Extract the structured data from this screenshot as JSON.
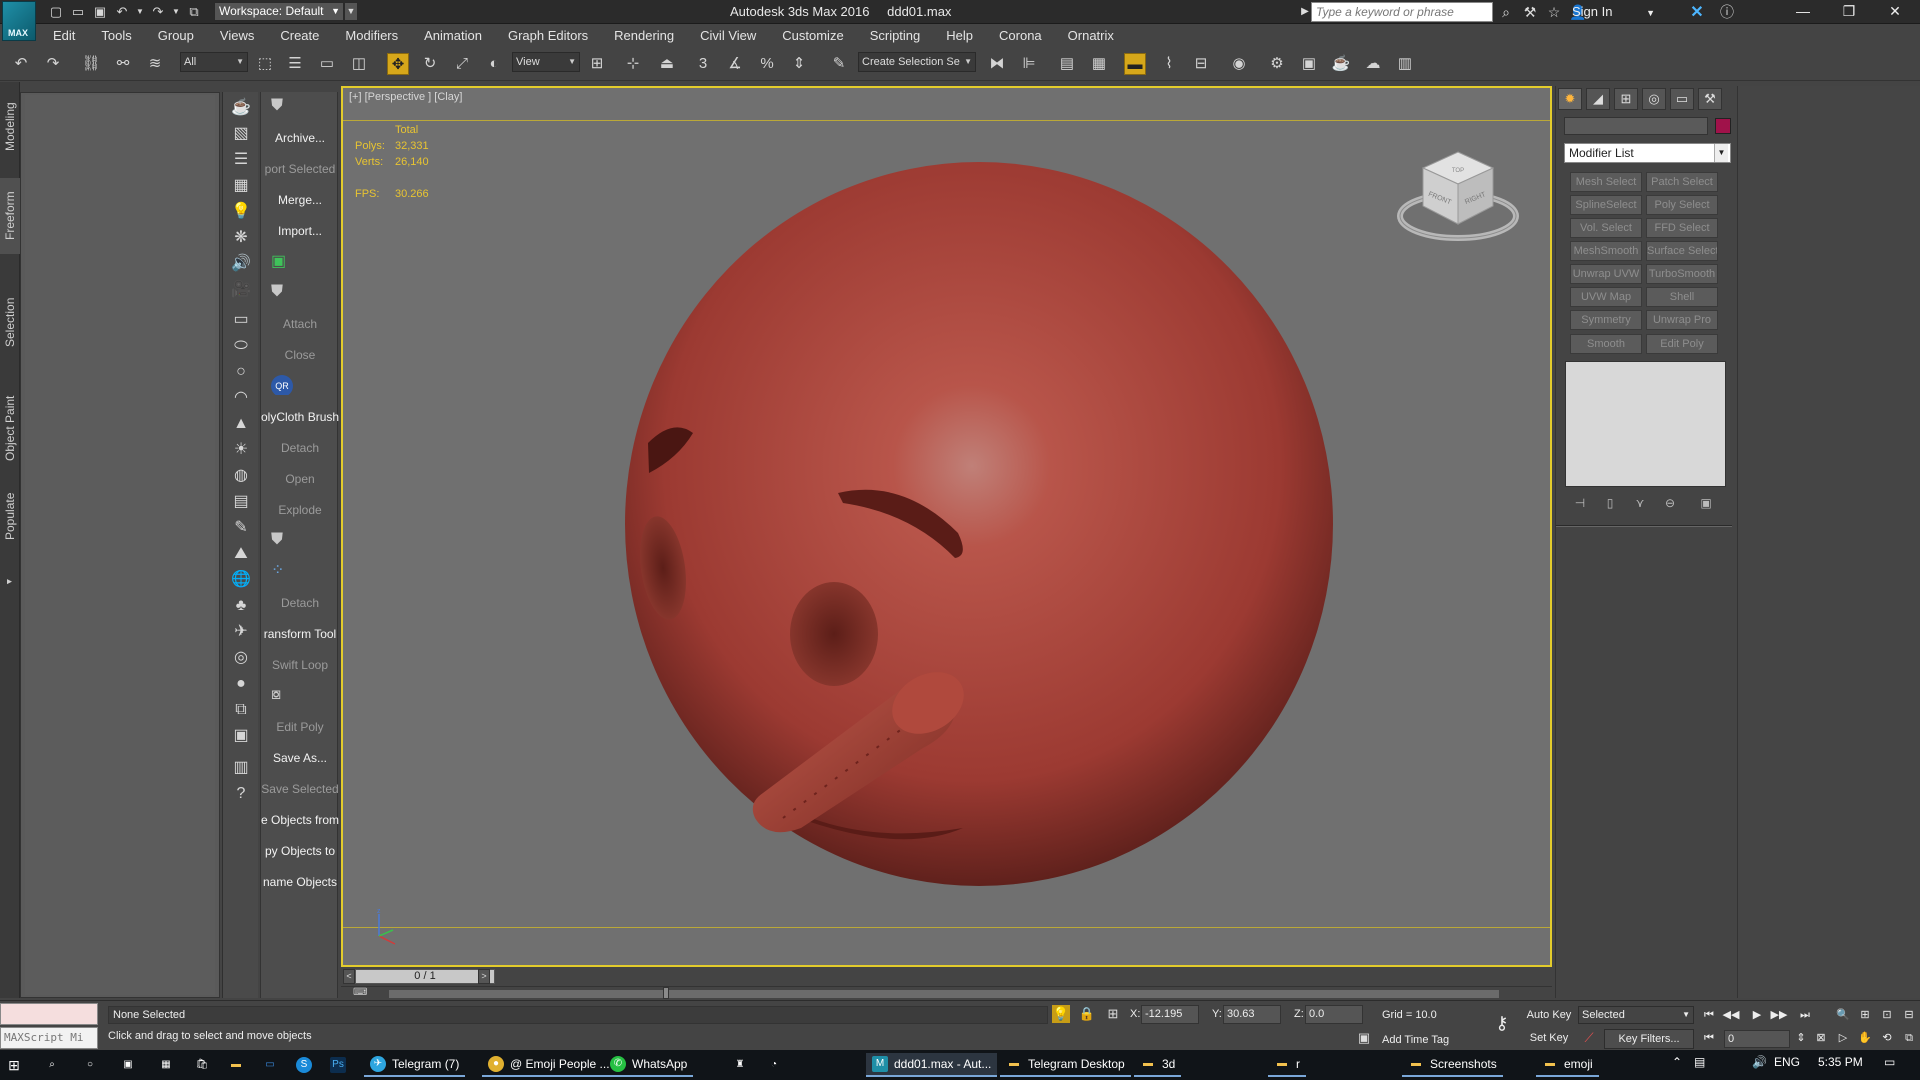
{
  "titlebar": {
    "workspace": "Workspace: Default",
    "app_title": "Autodesk 3ds Max 2016",
    "file_name": "ddd01.max",
    "search_placeholder": "Type a keyword or phrase",
    "sign_in": "Sign In",
    "logo_text": "MAX"
  },
  "menu": [
    "Edit",
    "Tools",
    "Group",
    "Views",
    "Create",
    "Modifiers",
    "Animation",
    "Graph Editors",
    "Rendering",
    "Civil View",
    "Customize",
    "Scripting",
    "Help",
    "Corona",
    "Ornatrix"
  ],
  "toolbar": {
    "selection_filter": "All",
    "reference_coord": "View",
    "named_selection_placeholder": "Create Selection Se",
    "snap_value": "3"
  },
  "ribbon_tabs": [
    "Modeling",
    "Freeform",
    "Selection",
    "Object Paint",
    "Populate"
  ],
  "custom_column": {
    "archive": "Archive...",
    "export_selected": "port Selected",
    "merge": "Merge...",
    "import": "Import...",
    "attach": "Attach",
    "close": "Close",
    "qr_label": "QR",
    "polycloth": "olyCloth Brush",
    "detach1": "Detach",
    "open": "Open",
    "explode": "Explode",
    "detach2": "Detach",
    "transform_tool": "ransform Tool",
    "swift_loop": "Swift Loop",
    "edit_poly": "Edit Poly",
    "save_as": "Save As...",
    "save_selected": "Save Selected",
    "objects_from": "e Objects from",
    "objects_to": "py Objects to",
    "rename_objects": "name Objects"
  },
  "viewport": {
    "label": "[+] [Perspective ] [Clay]",
    "stats_header": "Total",
    "polys_label": "Polys:",
    "polys_value": "32,331",
    "verts_label": "Verts:",
    "verts_value": "26,140",
    "fps_label": "FPS:",
    "fps_value": "30.266",
    "viewcube_front": "FRONT",
    "viewcube_right": "RIGHT",
    "viewcube_top": "TOP",
    "axis_z": "z",
    "model_color": "#b54a40"
  },
  "command_panel": {
    "modifier_list": "Modifier List",
    "object_color": "#a0124a",
    "modifiers": [
      "Mesh Select",
      "Patch Select",
      "SplineSelect",
      "Poly Select",
      "Vol. Select",
      "FFD Select",
      "MeshSmooth",
      "Surface Select",
      "Unwrap UVW",
      "TurboSmooth",
      "UVW Map",
      "Shell",
      "Symmetry",
      "Unwrap Pro",
      "Smooth",
      "Edit Poly"
    ]
  },
  "timeline": {
    "frame_display": "0 / 1"
  },
  "status": {
    "maxscript": "MAXScript Mi",
    "selection": "None Selected",
    "prompt": "Click and drag to select and move objects",
    "x_label": "X:",
    "x_value": "-12.195",
    "y_label": "Y:",
    "y_value": "30.63",
    "z_label": "Z:",
    "z_value": "0.0",
    "grid": "Grid = 10.0",
    "add_time_tag": "Add Time Tag",
    "auto_key": "Auto Key",
    "set_key": "Set Key",
    "key_mode": "Selected",
    "key_filters": "Key Filters...",
    "current_frame": "0"
  },
  "taskbar": {
    "items": [
      "Telegram (7)",
      "@ Emoji People ...",
      "WhatsApp",
      "ddd01.max - Aut...",
      "Telegram Desktop",
      "3d",
      "r",
      "Screenshots",
      "emoji"
    ],
    "lang": "ENG",
    "time": "5:35 PM"
  }
}
